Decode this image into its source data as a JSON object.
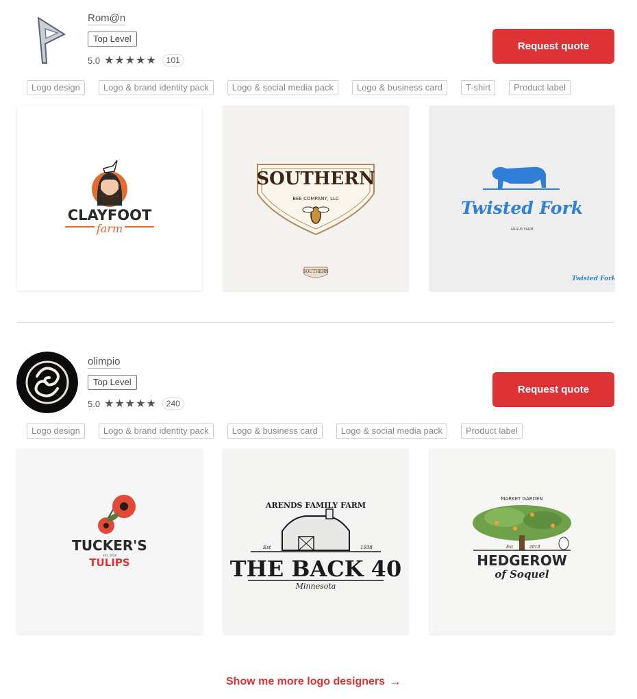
{
  "designers": [
    {
      "name": "Rom@n",
      "level": "Top Level",
      "rating": "5.0",
      "stars": "★★★★★",
      "review_count": "101",
      "quote_button": "Request quote",
      "tags": [
        "Logo design",
        "Logo & brand identity pack",
        "Logo & social media pack",
        "Logo & business card",
        "T-shirt",
        "Product label"
      ],
      "portfolio": [
        {
          "lines": [
            "CLAYFOOT",
            "farm"
          ]
        },
        {
          "lines": [
            "SOUTHERN",
            "BEE COMPANY, LLC",
            "SOUTHERN"
          ]
        },
        {
          "lines": [
            "Twisted Fork",
            "ANGUS FARM",
            "Twisted Fork"
          ]
        }
      ]
    },
    {
      "name": "olimpio",
      "level": "Top Level",
      "rating": "5.0",
      "stars": "★★★★★",
      "review_count": "240",
      "quote_button": "Request quote",
      "tags": [
        "Logo design",
        "Logo & brand identity pack",
        "Logo & business card",
        "Logo & social media pack",
        "Product label"
      ],
      "portfolio": [
        {
          "lines": [
            "TUCKER'S",
            "EST. 2018",
            "TULIPS"
          ]
        },
        {
          "lines": [
            "ARENDS FAMILY FARM",
            "THE BACK 40",
            "Minnesota",
            "Est",
            "1938"
          ]
        },
        {
          "lines": [
            "MARKET GARDEN",
            "HEDGEROW",
            "of Soquel",
            "Est",
            "2018"
          ]
        }
      ]
    }
  ],
  "more_link": "Show me more logo designers",
  "icons": {
    "arrow": "arrow-right-icon",
    "star": "star-icon"
  },
  "colors": {
    "accent": "#dd3236",
    "orange": "#e2692f",
    "blue": "#2f7fd6"
  }
}
